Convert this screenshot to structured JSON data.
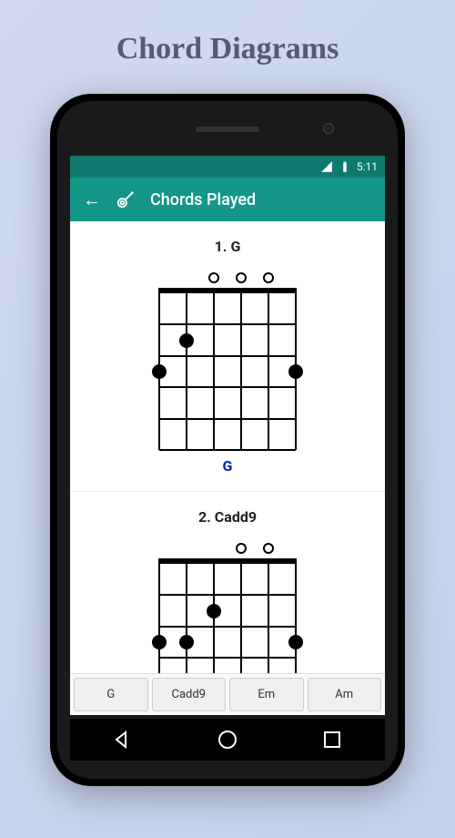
{
  "page": {
    "title": "Chord Diagrams"
  },
  "status": {
    "time": "5:11"
  },
  "appbar": {
    "title": "Chords Played"
  },
  "chords": [
    {
      "title": "1. G",
      "label": "G",
      "open": [
        3,
        4,
        5
      ],
      "fingers": [
        {
          "string": 2,
          "fret": 2
        },
        {
          "string": 1,
          "fret": 3
        },
        {
          "string": 6,
          "fret": 3
        }
      ],
      "showLabel": true
    },
    {
      "title": "2. Cadd9",
      "label": "Cadd9",
      "open": [
        4,
        5
      ],
      "fingers": [
        {
          "string": 3,
          "fret": 2
        },
        {
          "string": 1,
          "fret": 3
        },
        {
          "string": 2,
          "fret": 3
        },
        {
          "string": 6,
          "fret": 3
        }
      ],
      "showLabel": false
    }
  ],
  "tabs": [
    "G",
    "Cadd9",
    "Em",
    "Am"
  ]
}
